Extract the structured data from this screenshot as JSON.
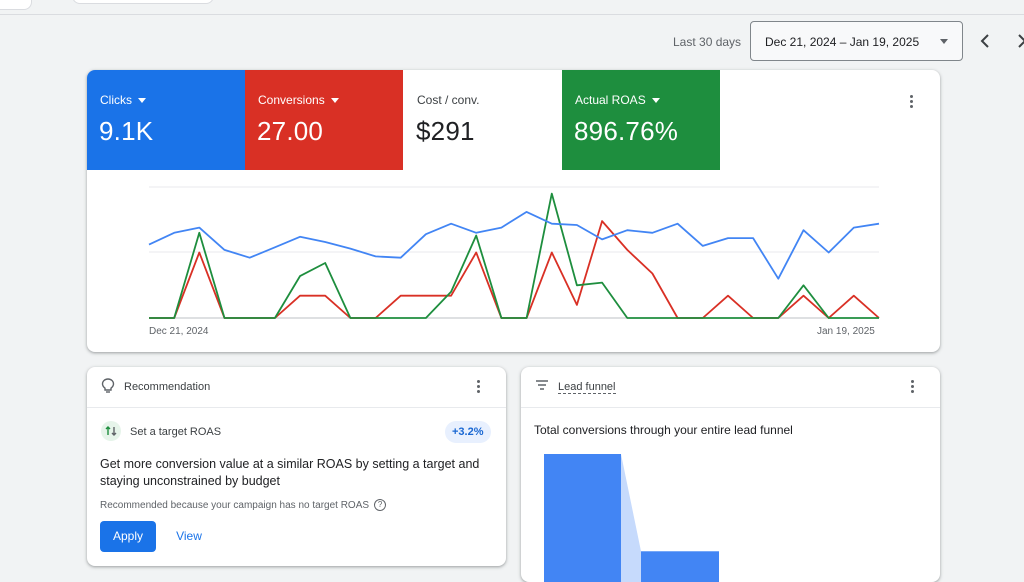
{
  "date_range": {
    "preset_label": "Last 30 days",
    "value": "Dec 21, 2024 – Jan 19, 2025"
  },
  "metrics": [
    {
      "label": "Clicks",
      "value": "9.1K",
      "color": "#1a73e8",
      "dropdown": true
    },
    {
      "label": "Conversions",
      "value": "27.00",
      "color": "#d93025",
      "dropdown": true
    },
    {
      "label": "Cost / conv.",
      "value": "$291",
      "color": "#ffffff",
      "dropdown": false
    },
    {
      "label": "Actual ROAS",
      "value": "896.76%",
      "color": "#1e8e3e",
      "dropdown": true
    }
  ],
  "chart_data": {
    "type": "line",
    "x_start_label": "Dec 21, 2024",
    "x_end_label": "Jan 19, 2025",
    "grid": true,
    "series": [
      {
        "color": "#4285f4",
        "values": [
          0.56,
          0.65,
          0.69,
          0.52,
          0.46,
          0.54,
          0.62,
          0.58,
          0.53,
          0.47,
          0.46,
          0.64,
          0.72,
          0.65,
          0.69,
          0.81,
          0.72,
          0.71,
          0.6,
          0.67,
          0.65,
          0.72,
          0.55,
          0.61,
          0.61,
          0.3,
          0.67,
          0.5,
          0.69,
          0.72
        ]
      },
      {
        "color": "#d93025",
        "values": [
          0,
          0,
          0.5,
          0,
          0,
          0,
          0.17,
          0.17,
          0,
          0,
          0.17,
          0.17,
          0.17,
          0.5,
          0,
          0,
          0.5,
          0.1,
          0.74,
          0.52,
          0.34,
          0,
          0,
          0.17,
          0,
          0,
          0.17,
          0,
          0.17,
          0
        ]
      },
      {
        "color": "#1e8e3e",
        "values": [
          0,
          0,
          0.65,
          0,
          0,
          0,
          0.32,
          0.42,
          0,
          0,
          0,
          0,
          0.2,
          0.63,
          0,
          0,
          0.95,
          0.25,
          0.27,
          0,
          0,
          0,
          0,
          0,
          0,
          0,
          0.25,
          0,
          0,
          0
        ]
      }
    ]
  },
  "recommendation": {
    "header": "Recommendation",
    "subtitle": "Set a target ROAS",
    "badge": "+3.2%",
    "main_text": "Get more conversion value at a similar ROAS by setting a target and staying unconstrained by budget",
    "note": "Recommended because your campaign has no target ROAS",
    "apply_label": "Apply",
    "view_label": "View"
  },
  "lead_funnel": {
    "header": "Lead funnel",
    "title": "Total conversions through your entire lead funnel",
    "stage_values": [
      1.0,
      0.24
    ],
    "bar_color": "#4285f4"
  }
}
